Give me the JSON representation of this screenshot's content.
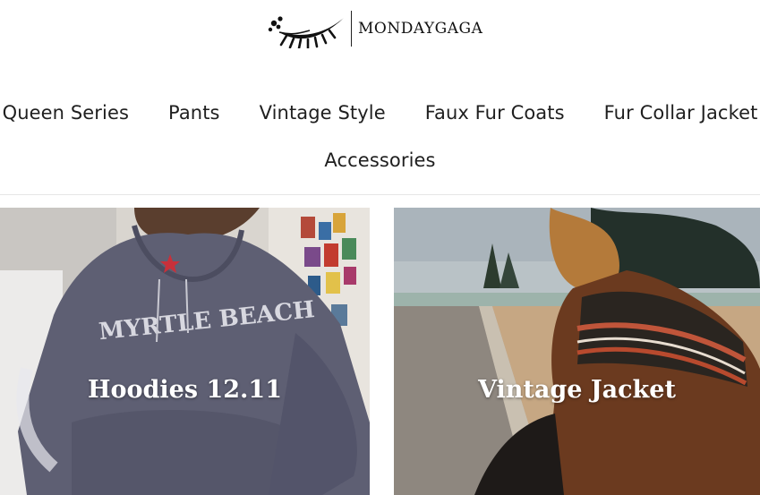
{
  "brand": {
    "name": "MONDAYGAGA",
    "logo_icon": "eyelash-logo-icon"
  },
  "nav": {
    "row1": [
      "Queen Series",
      "Pants",
      "Vintage Style",
      "Faux Fur Coats",
      "Fur Collar Jacket"
    ],
    "row2": [
      "Accessories"
    ]
  },
  "collections": [
    {
      "title": "Hoodies 12.11",
      "image": "hoodie-photo"
    },
    {
      "title": "Vintage Jacket",
      "image": "vintage-jacket-photo"
    }
  ],
  "colors": {
    "text": "#1b1b1b",
    "hoodie": "#5e5f73",
    "jacket_brown": "#6b3a1f"
  }
}
